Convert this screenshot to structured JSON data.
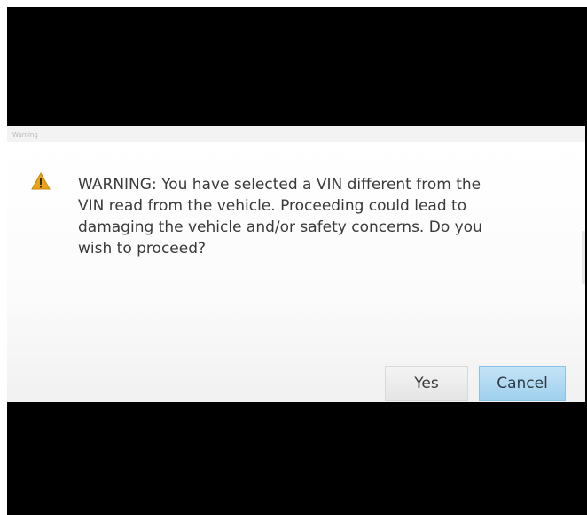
{
  "dialog": {
    "title": "Warning",
    "message": "WARNING:  You have selected a VIN different from the\nVIN read from the vehicle.  Proceeding could lead to\ndamaging the vehicle and/or safety concerns.  Do you\nwish to proceed?",
    "icon": "warning-triangle-icon",
    "buttons": {
      "yes_label": "Yes",
      "cancel_label": "Cancel"
    }
  },
  "colors": {
    "warning_icon": "#e8a317",
    "default_button": "#a8d5f0"
  }
}
